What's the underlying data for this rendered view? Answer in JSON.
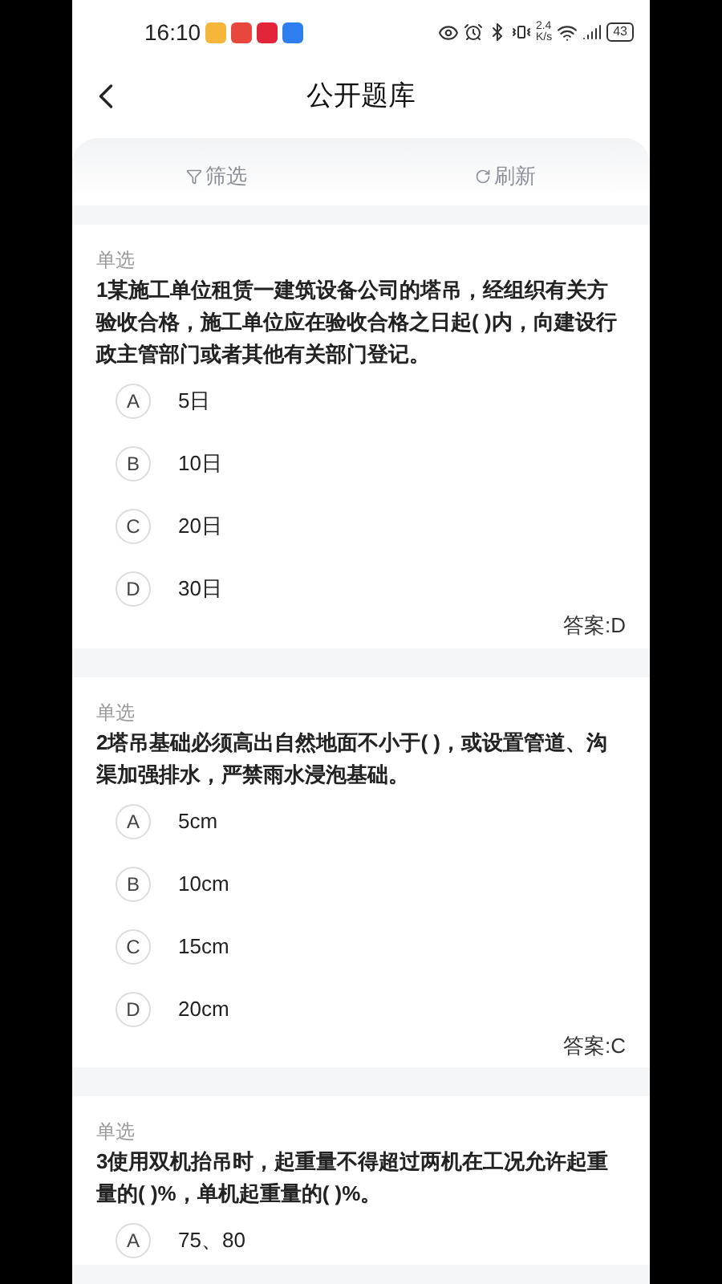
{
  "status_bar": {
    "time": "16:10",
    "net_speed": "2.4",
    "net_unit": "K/s",
    "battery": "43"
  },
  "header": {
    "title": "公开题库"
  },
  "toolbar": [
    {
      "kind": "filter",
      "label": "筛选"
    },
    {
      "kind": "refresh",
      "label": "刷新"
    }
  ],
  "questions": [
    {
      "type": "单选",
      "text": "1某施工单位租赁一建筑设备公司的塔吊，经组织有关方验收合格，施工单位应在验收合格之日起( )内，向建设行政主管部门或者其他有关部门登记。",
      "options": [
        {
          "letter": "A",
          "text": "5日"
        },
        {
          "letter": "B",
          "text": "10日"
        },
        {
          "letter": "C",
          "text": "20日"
        },
        {
          "letter": "D",
          "text": "30日"
        }
      ],
      "answer": "答案:D"
    },
    {
      "type": "单选",
      "text": "2塔吊基础必须高出自然地面不小于( )，或设置管道、沟渠加强排水，严禁雨水浸泡基础。",
      "options": [
        {
          "letter": "A",
          "text": "5cm"
        },
        {
          "letter": "B",
          "text": "10cm"
        },
        {
          "letter": "C",
          "text": "15cm"
        },
        {
          "letter": "D",
          "text": "20cm"
        }
      ],
      "answer": "答案:C"
    },
    {
      "type": "单选",
      "text": "3使用双机抬吊时，起重量不得超过两机在工况允许起重量的( )%，单机起重量的( )%。",
      "options": [
        {
          "letter": "A",
          "text": "75、80"
        }
      ]
    }
  ]
}
